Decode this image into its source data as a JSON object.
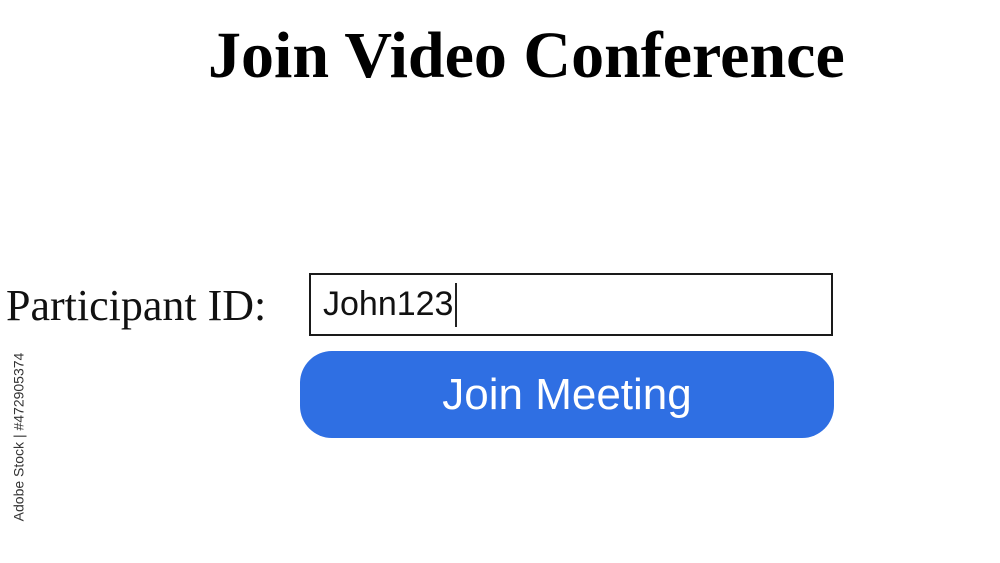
{
  "page": {
    "title": "Join Video Conference"
  },
  "form": {
    "participant_label": "Participant ID:",
    "participant_value": "John123",
    "join_label": "Join Meeting"
  },
  "watermark": {
    "credit": "Adobe Stock | #472905374"
  },
  "colors": {
    "button": "#2f6fe3",
    "button_text": "#ffffff",
    "background": "#ffffff"
  }
}
